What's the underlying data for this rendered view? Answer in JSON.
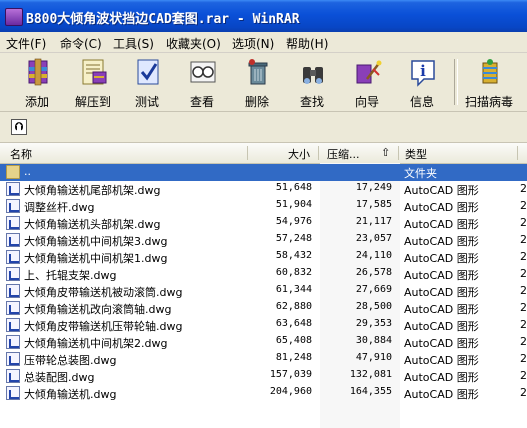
{
  "window": {
    "title": "B800大倾角波状挡边CAD套图.rar - WinRAR"
  },
  "menu": [
    "文件(F)",
    "命令(C)",
    "工具(S)",
    "收藏夹(O)",
    "选项(N)",
    "帮助(H)"
  ],
  "toolbar": [
    "添加",
    "解压到",
    "测试",
    "查看",
    "删除",
    "查找",
    "向导",
    "信息",
    "扫描病毒"
  ],
  "columns": {
    "name": "名称",
    "size": "大小",
    "packed": "压缩...",
    "type": "类型"
  },
  "up_row": {
    "name": "..",
    "type": "文件夹"
  },
  "files": [
    {
      "name": "大倾角输送机尾部机架.dwg",
      "size": "51,648",
      "packed": "17,249",
      "type": "AutoCAD 图形",
      "trail": "2"
    },
    {
      "name": "调整丝杆.dwg",
      "size": "51,904",
      "packed": "17,585",
      "type": "AutoCAD 图形",
      "trail": "2"
    },
    {
      "name": "大倾角输送机头部机架.dwg",
      "size": "54,976",
      "packed": "21,117",
      "type": "AutoCAD 图形",
      "trail": "2"
    },
    {
      "name": "大倾角输送机中间机架3.dwg",
      "size": "57,248",
      "packed": "23,057",
      "type": "AutoCAD 图形",
      "trail": "2"
    },
    {
      "name": "大倾角输送机中间机架1.dwg",
      "size": "58,432",
      "packed": "24,110",
      "type": "AutoCAD 图形",
      "trail": "2"
    },
    {
      "name": "上、托辊支架.dwg",
      "size": "60,832",
      "packed": "26,578",
      "type": "AutoCAD 图形",
      "trail": "2"
    },
    {
      "name": "大倾角皮带输送机被动滚筒.dwg",
      "size": "61,344",
      "packed": "27,669",
      "type": "AutoCAD 图形",
      "trail": "2"
    },
    {
      "name": "大倾角输送机改向滚筒轴.dwg",
      "size": "62,880",
      "packed": "28,500",
      "type": "AutoCAD 图形",
      "trail": "2"
    },
    {
      "name": "大倾角皮带输送机压带轮轴.dwg",
      "size": "63,648",
      "packed": "29,353",
      "type": "AutoCAD 图形",
      "trail": "2"
    },
    {
      "name": "大倾角输送机中间机架2.dwg",
      "size": "65,408",
      "packed": "30,884",
      "type": "AutoCAD 图形",
      "trail": "2"
    },
    {
      "name": "压带轮总装图.dwg",
      "size": "81,248",
      "packed": "47,910",
      "type": "AutoCAD 图形",
      "trail": "2"
    },
    {
      "name": "总装配图.dwg",
      "size": "157,039",
      "packed": "132,081",
      "type": "AutoCAD 图形",
      "trail": "2"
    },
    {
      "name": "大倾角输送机.dwg",
      "size": "204,960",
      "packed": "164,355",
      "type": "AutoCAD 图形",
      "trail": "2"
    }
  ],
  "icons": {
    "toolbar": [
      "add-archive-icon",
      "extract-to-icon",
      "test-icon",
      "view-icon",
      "delete-icon",
      "find-icon",
      "wizard-icon",
      "info-icon",
      "virus-scan-icon"
    ],
    "file": "autocad-dwg-icon",
    "folder": "folder-up-icon",
    "up_button": "up-arrow-icon"
  }
}
